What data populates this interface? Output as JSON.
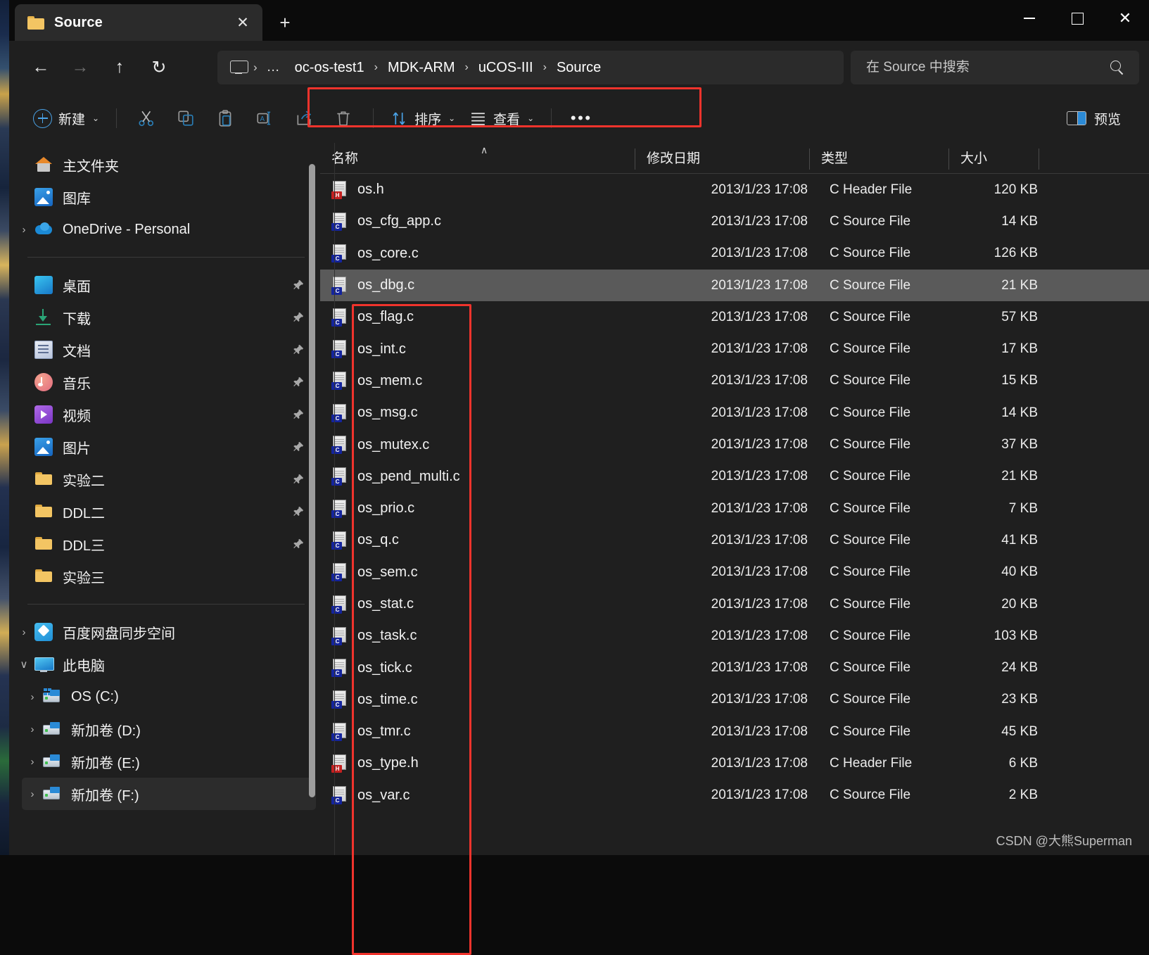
{
  "window": {
    "tab_title": "Source",
    "tab_close_icon": "close-icon",
    "new_tab_icon": "plus-icon",
    "minimize_icon": "minimize-icon",
    "maximize_icon": "maximize-icon",
    "close_icon": "close-icon"
  },
  "nav": {
    "back_icon": "arrow-left-icon",
    "forward_icon": "arrow-right-icon",
    "up_icon": "arrow-up-icon",
    "refresh_icon": "refresh-icon",
    "address_monitor_icon": "monitor-icon",
    "address_separator": "›",
    "overflow_label": "…",
    "breadcrumbs": [
      "oc-os-test1",
      "MDK-ARM",
      "uCOS-III",
      "Source"
    ],
    "breadcrumb_separator": "›"
  },
  "search": {
    "placeholder": "在 Source 中搜索",
    "value": "",
    "icon": "search-icon"
  },
  "toolbar": {
    "new_label": "新建",
    "new_icon": "plus-circle-icon",
    "chevron": "⌄",
    "cut_icon": "scissors-icon",
    "copy_icon": "copy-icon",
    "paste_icon": "paste-icon",
    "rename_icon": "rename-icon",
    "share_icon": "share-icon",
    "delete_icon": "trash-icon",
    "sort_label": "排序",
    "sort_icon": "sort-arrows-icon",
    "view_label": "查看",
    "view_icon": "list-view-icon",
    "more_label": "•••",
    "preview_label": "预览",
    "preview_icon": "preview-pane-icon"
  },
  "sidebar": {
    "groups": [
      {
        "items": [
          {
            "label": "主文件夹",
            "icon": "home-icon",
            "expandable": false,
            "pinned": false
          },
          {
            "label": "图库",
            "icon": "gallery-icon",
            "expandable": false,
            "pinned": false
          },
          {
            "label": "OneDrive - Personal",
            "icon": "onedrive-icon",
            "expandable": true,
            "expanded": false,
            "pinned": false
          }
        ]
      },
      {
        "items": [
          {
            "label": "桌面",
            "icon": "desktop-icon",
            "expandable": false,
            "pinned": true
          },
          {
            "label": "下载",
            "icon": "downloads-icon",
            "expandable": false,
            "pinned": true
          },
          {
            "label": "文档",
            "icon": "documents-icon",
            "expandable": false,
            "pinned": true
          },
          {
            "label": "音乐",
            "icon": "music-icon",
            "expandable": false,
            "pinned": true
          },
          {
            "label": "视频",
            "icon": "videos-icon",
            "expandable": false,
            "pinned": true
          },
          {
            "label": "图片",
            "icon": "pictures-icon",
            "expandable": false,
            "pinned": true
          },
          {
            "label": "实验二",
            "icon": "folder-icon",
            "expandable": false,
            "pinned": true
          },
          {
            "label": "DDL二",
            "icon": "folder-icon",
            "expandable": false,
            "pinned": true
          },
          {
            "label": "DDL三",
            "icon": "folder-icon",
            "expandable": false,
            "pinned": true
          },
          {
            "label": "实验三",
            "icon": "folder-icon",
            "expandable": false,
            "pinned": false
          }
        ]
      },
      {
        "items": [
          {
            "label": "百度网盘同步空间",
            "icon": "baidu-netdisk-icon",
            "expandable": true,
            "expanded": false,
            "pinned": false
          },
          {
            "label": "此电脑",
            "icon": "this-pc-icon",
            "expandable": true,
            "expanded": true,
            "pinned": false
          },
          {
            "label": "OS (C:)",
            "icon": "os-drive-icon",
            "expandable": true,
            "expanded": false,
            "pinned": false,
            "indent": true
          },
          {
            "label": "新加卷 (D:)",
            "icon": "drive-icon",
            "expandable": true,
            "expanded": false,
            "pinned": false,
            "indent": true
          },
          {
            "label": "新加卷 (E:)",
            "icon": "drive-icon",
            "expandable": true,
            "expanded": false,
            "pinned": false,
            "indent": true
          },
          {
            "label": "新加卷 (F:)",
            "icon": "drive-icon",
            "expandable": true,
            "expanded": false,
            "pinned": false,
            "indent": true,
            "highlight": true
          }
        ]
      }
    ],
    "chevron_collapsed": "›",
    "chevron_expanded": "∨",
    "pin_icon": "pin-icon"
  },
  "filelist": {
    "columns": [
      "名称",
      "修改日期",
      "类型",
      "大小"
    ],
    "sort_caret": "∧",
    "rows": [
      {
        "name": "os.h",
        "date": "2013/1/23 17:08",
        "type": "C Header File",
        "size": "120 KB",
        "icon": "c-header-file-icon",
        "selected": false
      },
      {
        "name": "os_cfg_app.c",
        "date": "2013/1/23 17:08",
        "type": "C Source File",
        "size": "14 KB",
        "icon": "c-source-file-icon",
        "selected": false
      },
      {
        "name": "os_core.c",
        "date": "2013/1/23 17:08",
        "type": "C Source File",
        "size": "126 KB",
        "icon": "c-source-file-icon",
        "selected": false
      },
      {
        "name": "os_dbg.c",
        "date": "2013/1/23 17:08",
        "type": "C Source File",
        "size": "21 KB",
        "icon": "c-source-file-icon",
        "selected": true
      },
      {
        "name": "os_flag.c",
        "date": "2013/1/23 17:08",
        "type": "C Source File",
        "size": "57 KB",
        "icon": "c-source-file-icon",
        "selected": false
      },
      {
        "name": "os_int.c",
        "date": "2013/1/23 17:08",
        "type": "C Source File",
        "size": "17 KB",
        "icon": "c-source-file-icon",
        "selected": false
      },
      {
        "name": "os_mem.c",
        "date": "2013/1/23 17:08",
        "type": "C Source File",
        "size": "15 KB",
        "icon": "c-source-file-icon",
        "selected": false
      },
      {
        "name": "os_msg.c",
        "date": "2013/1/23 17:08",
        "type": "C Source File",
        "size": "14 KB",
        "icon": "c-source-file-icon",
        "selected": false
      },
      {
        "name": "os_mutex.c",
        "date": "2013/1/23 17:08",
        "type": "C Source File",
        "size": "37 KB",
        "icon": "c-source-file-icon",
        "selected": false
      },
      {
        "name": "os_pend_multi.c",
        "date": "2013/1/23 17:08",
        "type": "C Source File",
        "size": "21 KB",
        "icon": "c-source-file-icon",
        "selected": false
      },
      {
        "name": "os_prio.c",
        "date": "2013/1/23 17:08",
        "type": "C Source File",
        "size": "7 KB",
        "icon": "c-source-file-icon",
        "selected": false
      },
      {
        "name": "os_q.c",
        "date": "2013/1/23 17:08",
        "type": "C Source File",
        "size": "41 KB",
        "icon": "c-source-file-icon",
        "selected": false
      },
      {
        "name": "os_sem.c",
        "date": "2013/1/23 17:08",
        "type": "C Source File",
        "size": "40 KB",
        "icon": "c-source-file-icon",
        "selected": false
      },
      {
        "name": "os_stat.c",
        "date": "2013/1/23 17:08",
        "type": "C Source File",
        "size": "20 KB",
        "icon": "c-source-file-icon",
        "selected": false
      },
      {
        "name": "os_task.c",
        "date": "2013/1/23 17:08",
        "type": "C Source File",
        "size": "103 KB",
        "icon": "c-source-file-icon",
        "selected": false
      },
      {
        "name": "os_tick.c",
        "date": "2013/1/23 17:08",
        "type": "C Source File",
        "size": "24 KB",
        "icon": "c-source-file-icon",
        "selected": false
      },
      {
        "name": "os_time.c",
        "date": "2013/1/23 17:08",
        "type": "C Source File",
        "size": "23 KB",
        "icon": "c-source-file-icon",
        "selected": false
      },
      {
        "name": "os_tmr.c",
        "date": "2013/1/23 17:08",
        "type": "C Source File",
        "size": "45 KB",
        "icon": "c-source-file-icon",
        "selected": false
      },
      {
        "name": "os_type.h",
        "date": "2013/1/23 17:08",
        "type": "C Header File",
        "size": "6 KB",
        "icon": "c-header-file-icon",
        "selected": false
      },
      {
        "name": "os_var.c",
        "date": "2013/1/23 17:08",
        "type": "C Source File",
        "size": "2 KB",
        "icon": "c-source-file-icon",
        "selected": false
      }
    ]
  },
  "annotations": {
    "accent_color": "#f0332c"
  },
  "watermark": "CSDN @大熊Superman"
}
